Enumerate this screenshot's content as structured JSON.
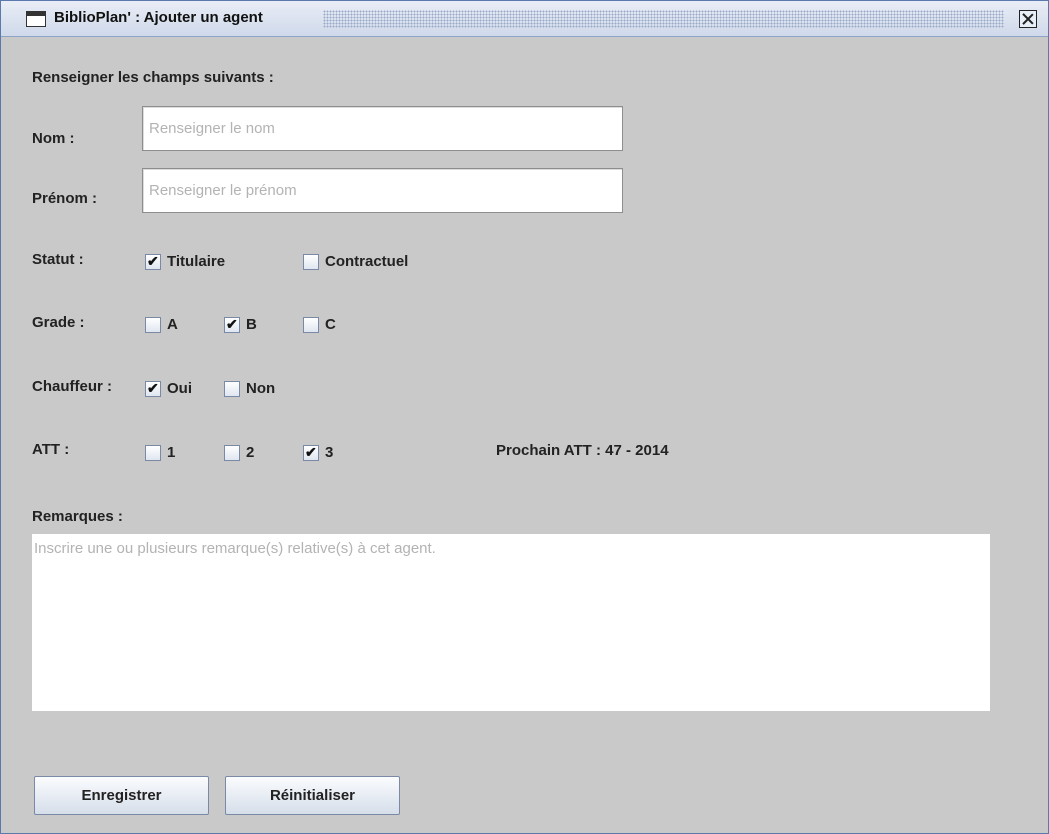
{
  "window": {
    "title": "BiblioPlan' : Ajouter un agent"
  },
  "form": {
    "intro": "Renseigner les champs suivants :",
    "nom": {
      "label": "Nom :",
      "value": "",
      "placeholder": "Renseigner le nom"
    },
    "prenom": {
      "label": "Prénom :",
      "value": "",
      "placeholder": "Renseigner le prénom"
    },
    "statut": {
      "label": "Statut :",
      "options": [
        {
          "label": "Titulaire",
          "checked": true
        },
        {
          "label": "Contractuel",
          "checked": false
        }
      ]
    },
    "grade": {
      "label": "Grade :",
      "options": [
        {
          "label": "A",
          "checked": false
        },
        {
          "label": "B",
          "checked": true
        },
        {
          "label": "C",
          "checked": false
        }
      ]
    },
    "chauffeur": {
      "label": "Chauffeur :",
      "options": [
        {
          "label": "Oui",
          "checked": true
        },
        {
          "label": "Non",
          "checked": false
        }
      ]
    },
    "att": {
      "label": "ATT :",
      "options": [
        {
          "label": "1",
          "checked": false
        },
        {
          "label": "2",
          "checked": false
        },
        {
          "label": "3",
          "checked": true
        }
      ],
      "next": "Prochain ATT : 47 - 2014"
    },
    "remarques": {
      "label": "Remarques :",
      "value": "",
      "placeholder": "Inscrire une ou plusieurs remarque(s) relative(s) à cet agent."
    }
  },
  "buttons": {
    "save": "Enregistrer",
    "reset": "Réinitialiser"
  }
}
